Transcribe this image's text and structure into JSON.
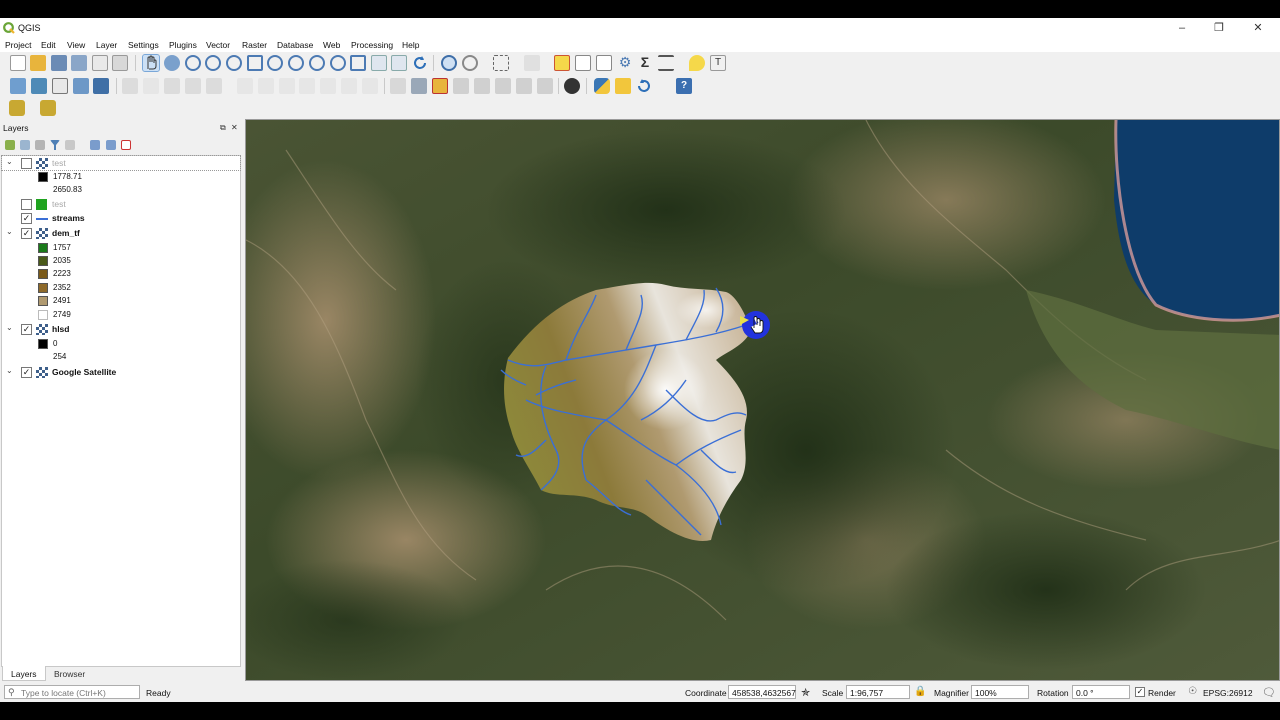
{
  "app": {
    "title": "QGIS"
  },
  "menu": [
    "Project",
    "Edit",
    "View",
    "Layer",
    "Settings",
    "Plugins",
    "Vector",
    "Raster",
    "Database",
    "Web",
    "Processing",
    "Help"
  ],
  "layers_panel": {
    "title": "Layers",
    "tabs": [
      "Layers",
      "Browser"
    ],
    "items": [
      {
        "name": "test",
        "checked": false,
        "legend": [
          "1778.71",
          "2650.83"
        ]
      },
      {
        "name": "test",
        "checked": false
      },
      {
        "name": "streams",
        "checked": true
      },
      {
        "name": "dem_tf",
        "checked": true,
        "legend": [
          "1757",
          "2035",
          "2223",
          "2352",
          "2491",
          "2749"
        ]
      },
      {
        "name": "hlsd",
        "checked": true,
        "legend": [
          "0",
          "254"
        ]
      },
      {
        "name": "Google Satellite",
        "checked": true
      }
    ]
  },
  "status": {
    "locate_placeholder": "Type to locate (Ctrl+K)",
    "state": "Ready",
    "coordinate_label": "Coordinate",
    "coordinate": "458538,4632567",
    "scale_label": "Scale",
    "scale": "1:96,757",
    "magnifier_label": "Magnifier",
    "magnifier": "100%",
    "rotation_label": "Rotation",
    "rotation": "0.0 °",
    "render_label": "Render",
    "crs": "EPSG:26912"
  },
  "colors": {
    "dem_ramp": [
      "#1a7a1a",
      "#4a5a1a",
      "#7a5a1a",
      "#8e6a2a",
      "#b09a70",
      "#ffffff"
    ],
    "streams": "#3a6fd6",
    "outlet": "#2233dd",
    "water": "#0e3c6a"
  }
}
